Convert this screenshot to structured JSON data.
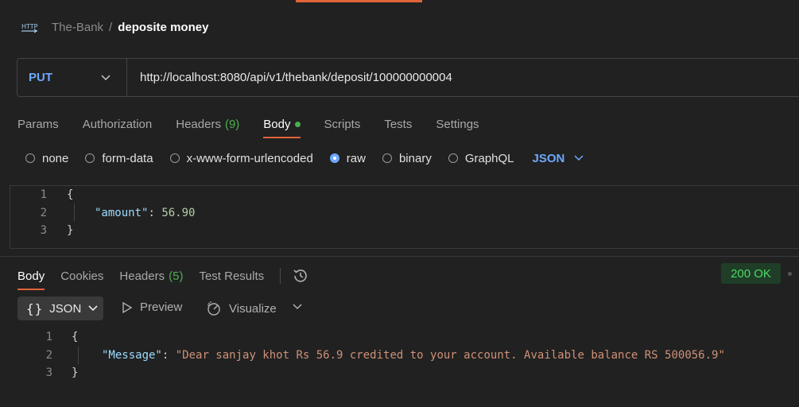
{
  "breadcrumb": {
    "icon": "http-icon",
    "icon_text": "HTTP",
    "collection": "The-Bank",
    "separator": "/",
    "request": "deposite money"
  },
  "request": {
    "method": "PUT",
    "url": "http://localhost:8080/api/v1/thebank/deposit/100000000004"
  },
  "request_tabs": [
    {
      "label": "Params"
    },
    {
      "label": "Authorization"
    },
    {
      "label": "Headers",
      "count": "(9)"
    },
    {
      "label": "Body",
      "active": true
    },
    {
      "label": "Scripts"
    },
    {
      "label": "Tests"
    },
    {
      "label": "Settings"
    }
  ],
  "body_types": {
    "options": [
      "none",
      "form-data",
      "x-www-form-urlencoded",
      "raw",
      "binary",
      "GraphQL"
    ],
    "selected": "raw",
    "format": "JSON"
  },
  "request_body": {
    "line_numbers": [
      "1",
      "2",
      "3"
    ],
    "open_brace": "{",
    "key": "\"amount\"",
    "colon": ":",
    "value": "56.90",
    "close_brace": "}"
  },
  "response_tabs": [
    {
      "label": "Body",
      "active": true
    },
    {
      "label": "Cookies"
    },
    {
      "label": "Headers",
      "count": "(5)"
    },
    {
      "label": "Test Results"
    }
  ],
  "status": "200 OK",
  "response_toolbar": {
    "format_label": "JSON",
    "braces": "{}",
    "preview_label": "Preview",
    "visualize_label": "Visualize"
  },
  "response_body": {
    "line_numbers": [
      "1",
      "2",
      "3"
    ],
    "open_brace": "{",
    "key": "\"Message\"",
    "colon": ":",
    "value": "\"Dear sanjay khot Rs 56.9 credited to your account. Available balance RS 500056.9\"",
    "close_brace": "}"
  },
  "colors": {
    "background": "#212121",
    "accent": "#e0633a",
    "method": "#6ea8ff",
    "success": "#4caf50"
  }
}
